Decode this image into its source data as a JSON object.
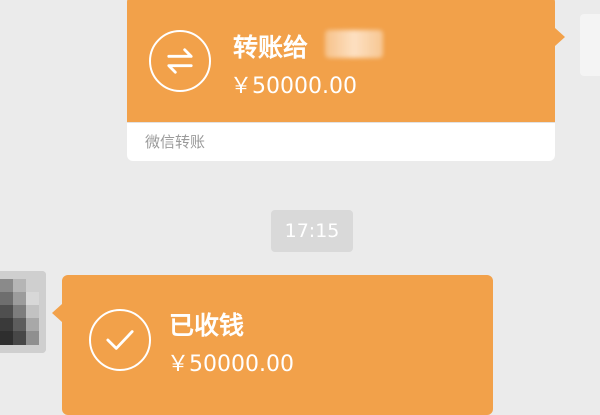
{
  "colors": {
    "background": "#ebebeb",
    "card_orange": "#f2a14a",
    "footer_text": "#9a9a9a",
    "time_badge": "#d9d9d9",
    "white": "#ffffff"
  },
  "sent_transfer": {
    "icon": "transfer-arrows-icon",
    "title": "转账给",
    "amount": "￥50000.00",
    "footer": "微信转账"
  },
  "timestamp": "17:15",
  "received_transfer": {
    "icon": "checkmark-icon",
    "title": "已收钱",
    "amount": "￥50000.00"
  }
}
